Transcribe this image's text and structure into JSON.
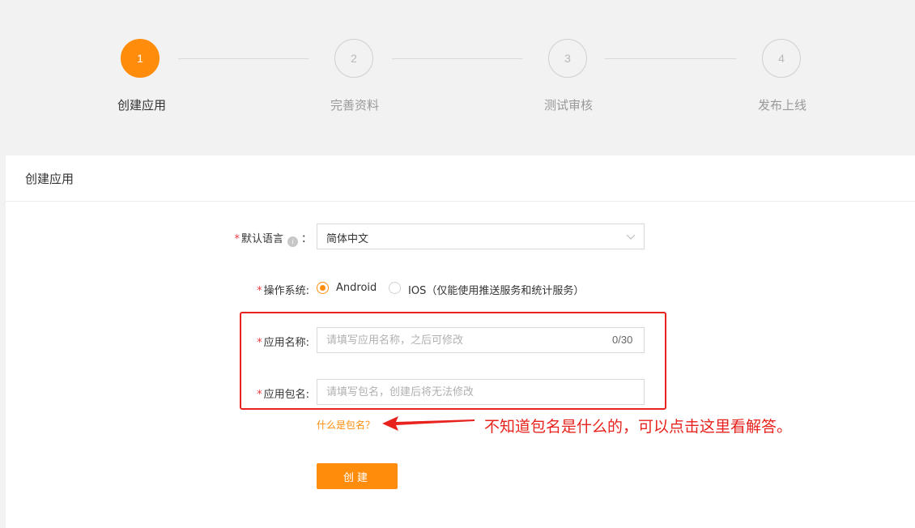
{
  "stepper": {
    "steps": [
      {
        "number": "1",
        "label": "创建应用",
        "active": true
      },
      {
        "number": "2",
        "label": "完善资料",
        "active": false
      },
      {
        "number": "3",
        "label": "测试审核",
        "active": false
      },
      {
        "number": "4",
        "label": "发布上线",
        "active": false
      }
    ]
  },
  "panel": {
    "title": "创建应用"
  },
  "form": {
    "required_mark": "*",
    "language": {
      "label": "默认语言",
      "info_icon": "info-icon",
      "colon": "：",
      "value": "简体中文",
      "dropdown_icon": "chevron-down-icon"
    },
    "os": {
      "label": "操作系统:",
      "options": [
        {
          "label": "Android",
          "checked": true
        },
        {
          "label": "IOS（仅能使用推送服务和统计服务）",
          "checked": false
        }
      ]
    },
    "app_name": {
      "label": "应用名称:",
      "placeholder": "请填写应用名称，之后可修改",
      "value": "",
      "counter": "0/30"
    },
    "package_name": {
      "label": "应用包名:",
      "placeholder": "请填写包名，创建后将无法修改",
      "value": ""
    },
    "help_link": "什么是包名？",
    "submit_label": "创建"
  },
  "annotation": {
    "text": "不知道包名是什么的，可以点击这里看解答。",
    "color": "#e8231d"
  },
  "colors": {
    "accent": "#ff8c0a",
    "annotation_red": "#e8231d",
    "page_bg": "#f2f2f2"
  }
}
